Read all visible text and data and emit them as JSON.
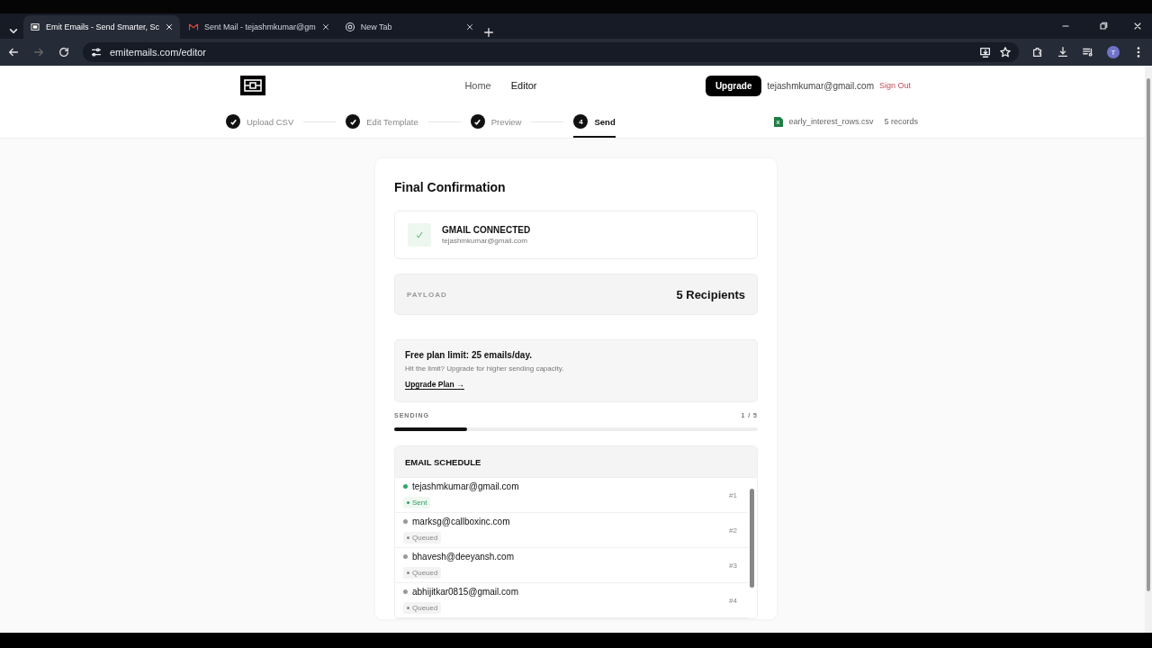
{
  "browser": {
    "tabs": [
      {
        "title": "Emit Emails - Send Smarter, Sc",
        "selected": true
      },
      {
        "title": "Sent Mail - tejashmkumar@gm",
        "selected": false
      },
      {
        "title": "New Tab",
        "selected": false
      }
    ],
    "url": "emitemails.com/editor",
    "profile": "T"
  },
  "nav": {
    "links": [
      {
        "label": "Home",
        "selected": false
      },
      {
        "label": "Editor",
        "selected": true
      }
    ],
    "upgrade": "Upgrade",
    "email": "tejashmkumar@gmail.com",
    "sign_out": "Sign Out"
  },
  "steps": [
    {
      "label": "Upload CSV",
      "completed": true,
      "selected": false
    },
    {
      "label": "Edit Template",
      "completed": true,
      "selected": false
    },
    {
      "label": "Preview",
      "completed": true,
      "selected": false
    },
    {
      "label": "Send",
      "completed": false,
      "selected": true,
      "number": "4"
    }
  ],
  "file": {
    "name": "early_interest_rows.csv",
    "records": "5 records"
  },
  "card": {
    "title": "Final Confirmation",
    "connection": {
      "title": "GMAIL CONNECTED",
      "email": "tejashmkumar@gmail.com"
    },
    "payload": {
      "label": "PAYLOAD",
      "value": "5 Recipients"
    },
    "limit": {
      "title": "Free plan limit: 25 emails/day.",
      "text": "Hit the limit? Upgrade for higher sending capacity.",
      "link": "Upgrade Plan →"
    },
    "progress": {
      "label": "SENDING",
      "count": "1 / 5",
      "level": 0.2
    },
    "schedule": {
      "title": "EMAIL SCHEDULE",
      "items": [
        {
          "email": "tejashmkumar@gmail.com",
          "kind": "sent",
          "label": "Sent",
          "index": "#1"
        },
        {
          "email": "marksg@callboxinc.com",
          "kind": "queued",
          "label": "Queued",
          "index": "#2"
        },
        {
          "email": "bhavesh@deeyansh.com",
          "kind": "queued",
          "label": "Queued",
          "index": "#3"
        },
        {
          "email": "abhijitkar0815@gmail.com",
          "kind": "queued",
          "label": "Queued",
          "index": "#4"
        }
      ]
    }
  }
}
